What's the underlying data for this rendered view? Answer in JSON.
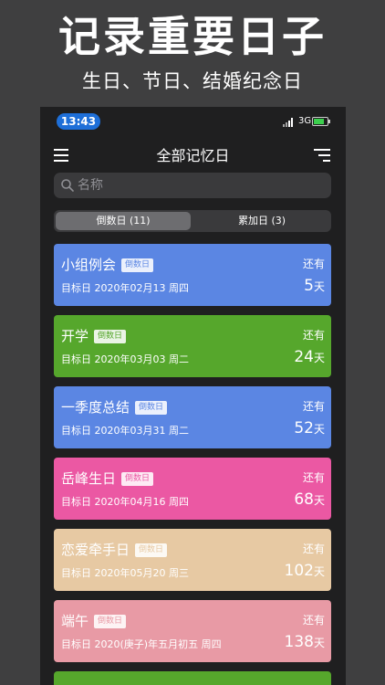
{
  "promo": {
    "title": "记录重要日子",
    "subtitle": "生日、节日、结婚纪念日"
  },
  "status_bar": {
    "time": "13:43",
    "network": "3G"
  },
  "nav": {
    "title": "全部记忆日",
    "left_icon": "menu-icon",
    "right_icon": "sort-icon"
  },
  "search": {
    "placeholder": "名称"
  },
  "segments": [
    {
      "label": "倒数日 (11)",
      "selected": true
    },
    {
      "label": "累加日 (3)",
      "selected": false
    }
  ],
  "cards": [
    {
      "name": "小组例会",
      "tag": "倒数日",
      "date": "目标日 2020年02月13 周四",
      "remain_label": "还有",
      "days": "5",
      "unit": "天",
      "color": "#5b86e3"
    },
    {
      "name": "开学",
      "tag": "倒数日",
      "date": "目标日 2020年03月03 周二",
      "remain_label": "还有",
      "days": "24",
      "unit": "天",
      "color": "#56a72c"
    },
    {
      "name": "一季度总结",
      "tag": "倒数日",
      "date": "目标日 2020年03月31 周二",
      "remain_label": "还有",
      "days": "52",
      "unit": "天",
      "color": "#5b86e3"
    },
    {
      "name": "岳峰生日",
      "tag": "倒数日",
      "date": "目标日 2020年04月16 周四",
      "remain_label": "还有",
      "days": "68",
      "unit": "天",
      "color": "#eb58a3"
    },
    {
      "name": "恋爱牵手日",
      "tag": "倒数日",
      "date": "目标日 2020年05月20 周三",
      "remain_label": "还有",
      "days": "102",
      "unit": "天",
      "color": "#e7c9a3"
    },
    {
      "name": "端午",
      "tag": "倒数日",
      "date": "目标日 2020(庚子)年五月初五 周四",
      "remain_label": "还有",
      "days": "138",
      "unit": "天",
      "color": "#e89aa5"
    }
  ],
  "next_card_color": "#56a72c"
}
